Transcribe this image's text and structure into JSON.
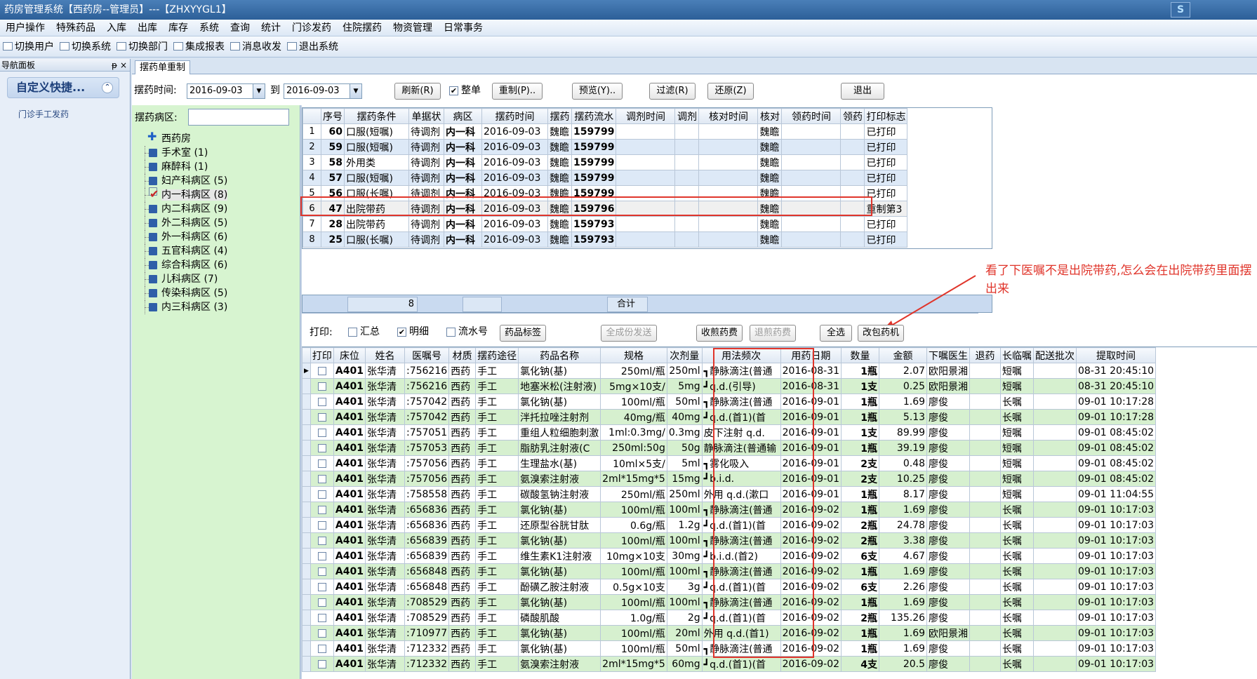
{
  "window": {
    "title": "药房管理系统【西药房--管理员】---【ZHXYYGL1】",
    "logo": "S"
  },
  "menu": [
    "用户操作",
    "特殊药品",
    "入库",
    "出库",
    "库存",
    "系统",
    "查询",
    "统计",
    "门诊发药",
    "住院摆药",
    "物资管理",
    "日常事务"
  ],
  "toolbar": [
    "切换用户",
    "切换系统",
    "切换部门",
    "集成报表",
    "消息收发",
    "退出系统"
  ],
  "nav": {
    "header": "导航面板",
    "pin": "ᵽ",
    "close": "×",
    "group": "自定义快捷...",
    "item": "门诊手工发药"
  },
  "tab": {
    "label": "摆药单重制"
  },
  "filter": {
    "time_label": "摆药时间:",
    "date_from": "2016-09-03",
    "to_label": "到",
    "date_to": "2016-09-03",
    "refresh": "刷新(R)",
    "whole_label": "整单",
    "remake": "重制(P)..",
    "preview": "预览(Y)..",
    "filter_btn": "过滤(R)",
    "restore": "还原(Z)",
    "exit": "退出",
    "ward_label": "摆药病区:"
  },
  "tree": {
    "root": "西药房",
    "items": [
      {
        "label": "手术室 (1)"
      },
      {
        "label": "麻醉科 (1)"
      },
      {
        "label": "妇产科病区 (5)"
      },
      {
        "label": "内一科病区 (8)",
        "checked": true
      },
      {
        "label": "内二科病区 (9)"
      },
      {
        "label": "外二科病区 (5)"
      },
      {
        "label": "外一科病区 (6)"
      },
      {
        "label": "五官科病区 (4)"
      },
      {
        "label": "综合科病区 (6)"
      },
      {
        "label": "儿科病区 (7)"
      },
      {
        "label": "传染科病区 (5)"
      },
      {
        "label": "内三科病区 (3)"
      }
    ]
  },
  "upper": {
    "headers": [
      "",
      "序号",
      "摆药条件",
      "单据状",
      "病区",
      "摆药时间",
      "摆药",
      "摆药流水",
      "调剂时间",
      "调剂",
      "核对时间",
      "核对",
      "领药时间",
      "领药",
      "打印标志"
    ],
    "rows": [
      [
        "1",
        "60",
        "口服(短嘱)",
        "待调剂",
        "内一科",
        "2016-09-03",
        "魏瞻",
        "159799",
        "",
        "",
        "",
        "魏瞻",
        "",
        "",
        "已打印"
      ],
      [
        "2",
        "59",
        "口服(短嘱)",
        "待调剂",
        "内一科",
        "2016-09-03",
        "魏瞻",
        "159799",
        "",
        "",
        "",
        "魏瞻",
        "",
        "",
        "已打印"
      ],
      [
        "3",
        "58",
        "外用类",
        "待调剂",
        "内一科",
        "2016-09-03",
        "魏瞻",
        "159799",
        "",
        "",
        "",
        "魏瞻",
        "",
        "",
        "已打印"
      ],
      [
        "4",
        "57",
        "口服(短嘱)",
        "待调剂",
        "内一科",
        "2016-09-03",
        "魏瞻",
        "159799",
        "",
        "",
        "",
        "魏瞻",
        "",
        "",
        "已打印"
      ],
      [
        "5",
        "56",
        "口服(长嘱)",
        "待调剂",
        "内一科",
        "2016-09-03",
        "魏瞻",
        "159799",
        "",
        "",
        "",
        "魏瞻",
        "",
        "",
        "已打印"
      ],
      [
        "6",
        "47",
        "出院带药",
        "待调剂",
        "内一科",
        "2016-09-03",
        "魏瞻",
        "159796",
        "",
        "",
        "",
        "魏瞻",
        "",
        "",
        "重制第3"
      ],
      [
        "7",
        "28",
        "出院带药",
        "待调剂",
        "内一科",
        "2016-09-03",
        "魏瞻",
        "159793",
        "",
        "",
        "",
        "魏瞻",
        "",
        "",
        "已打印"
      ],
      [
        "8",
        "25",
        "口服(长嘱)",
        "待调剂",
        "内一科",
        "2016-09-03",
        "魏瞻",
        "159793",
        "",
        "",
        "",
        "魏瞻",
        "",
        "",
        "已打印"
      ]
    ],
    "sum_count": "8",
    "sum_label": "合计"
  },
  "annotation": "看了下医嘱不是出院带药,怎么会在出院带药里面摆出来",
  "printbar": {
    "print_label": "打印:",
    "summary": "汇总",
    "detail": "明细",
    "serial": "流水号",
    "drug_label_btn": "药品标签",
    "send_btn": "全成份发送",
    "collect_btn": "收煎药费",
    "refund_btn": "退煎药费",
    "select_all": "全选",
    "change_machine": "改包药机"
  },
  "lower": {
    "headers": [
      "",
      "打印",
      "床位",
      "姓名",
      "医嘱号",
      "材质",
      "摆药途径",
      "药品名称",
      "规格",
      "次剂量",
      "用法频次",
      "用药日期",
      "数量",
      "金额",
      "下嘱医生",
      "退药",
      "长临嘱",
      "配送批次",
      "提取时间"
    ],
    "rows": [
      [
        "A401",
        "张华清",
        ":756216",
        "西药",
        "手工",
        "氯化钠(基)",
        "250ml/瓶",
        "250ml",
        "┓静脉滴注(普通",
        "2016-08-31",
        "1瓶",
        "2.07",
        "欧阳景湘",
        "",
        "短嘱",
        "",
        "08-31 20:45:10"
      ],
      [
        "A401",
        "张华清",
        ":756216",
        "西药",
        "手工",
        "地塞米松(注射液)",
        "5mg×10支/",
        "5mg",
        "┛q.d.(引导)",
        "2016-08-31",
        "1支",
        "0.25",
        "欧阳景湘",
        "",
        "短嘱",
        "",
        "08-31 20:45:10"
      ],
      [
        "A401",
        "张华清",
        ":757042",
        "西药",
        "手工",
        "氯化钠(基)",
        "100ml/瓶",
        "50ml",
        "┓静脉滴注(普通",
        "2016-09-01",
        "1瓶",
        "1.69",
        "廖俊",
        "",
        "长嘱",
        "",
        "09-01 10:17:28"
      ],
      [
        "A401",
        "张华清",
        ":757042",
        "西药",
        "手工",
        "泮托拉唑注射剂",
        "40mg/瓶",
        "40mg",
        "┛q.d.(首1)(首",
        "2016-09-01",
        "1瓶",
        "5.13",
        "廖俊",
        "",
        "长嘱",
        "",
        "09-01 10:17:28"
      ],
      [
        "A401",
        "张华清",
        ":757051",
        "西药",
        "手工",
        "重组人粒细胞刺激",
        "1ml:0.3mg/",
        "0.3mg",
        "皮下注射 q.d.",
        "2016-09-01",
        "1支",
        "89.99",
        "廖俊",
        "",
        "短嘱",
        "",
        "09-01 08:45:02"
      ],
      [
        "A401",
        "张华清",
        ":757053",
        "西药",
        "手工",
        "脂肪乳注射液(C",
        "250ml:50g",
        "50g",
        "静脉滴注(普通输",
        "2016-09-01",
        "1瓶",
        "39.19",
        "廖俊",
        "",
        "短嘱",
        "",
        "09-01 08:45:02"
      ],
      [
        "A401",
        "张华清",
        ":757056",
        "西药",
        "手工",
        "生理盐水(基)",
        "10ml×5支/",
        "5ml",
        "┓雾化吸入",
        "2016-09-01",
        "2支",
        "0.48",
        "廖俊",
        "",
        "短嘱",
        "",
        "09-01 08:45:02"
      ],
      [
        "A401",
        "张华清",
        ":757056",
        "西药",
        "手工",
        "氨溴索注射液",
        "2ml*15mg*5",
        "15mg",
        "┛b.i.d.",
        "2016-09-01",
        "2支",
        "10.25",
        "廖俊",
        "",
        "短嘱",
        "",
        "09-01 08:45:02"
      ],
      [
        "A401",
        "张华清",
        ":758558",
        "西药",
        "手工",
        "碳酸氢钠注射液",
        "250ml/瓶",
        "250ml",
        "外用 q.d.(漱口",
        "2016-09-01",
        "1瓶",
        "8.17",
        "廖俊",
        "",
        "短嘱",
        "",
        "09-01 11:04:55"
      ],
      [
        "A401",
        "张华清",
        ":656836",
        "西药",
        "手工",
        "氯化钠(基)",
        "100ml/瓶",
        "100ml",
        "┓静脉滴注(普通",
        "2016-09-02",
        "1瓶",
        "1.69",
        "廖俊",
        "",
        "长嘱",
        "",
        "09-01 10:17:03"
      ],
      [
        "A401",
        "张华清",
        ":656836",
        "西药",
        "手工",
        "还原型谷胱甘肽",
        "0.6g/瓶",
        "1.2g",
        "┛q.d.(首1)(首",
        "2016-09-02",
        "2瓶",
        "24.78",
        "廖俊",
        "",
        "长嘱",
        "",
        "09-01 10:17:03"
      ],
      [
        "A401",
        "张华清",
        ":656839",
        "西药",
        "手工",
        "氯化钠(基)",
        "100ml/瓶",
        "100ml",
        "┓静脉滴注(普通",
        "2016-09-02",
        "2瓶",
        "3.38",
        "廖俊",
        "",
        "长嘱",
        "",
        "09-01 10:17:03"
      ],
      [
        "A401",
        "张华清",
        ":656839",
        "西药",
        "手工",
        "维生素K1注射液",
        "10mg×10支",
        "30mg",
        "┛b.i.d.(首2)",
        "2016-09-02",
        "6支",
        "4.67",
        "廖俊",
        "",
        "长嘱",
        "",
        "09-01 10:17:03"
      ],
      [
        "A401",
        "张华清",
        ":656848",
        "西药",
        "手工",
        "氯化钠(基)",
        "100ml/瓶",
        "100ml",
        "┓静脉滴注(普通",
        "2016-09-02",
        "1瓶",
        "1.69",
        "廖俊",
        "",
        "长嘱",
        "",
        "09-01 10:17:03"
      ],
      [
        "A401",
        "张华清",
        ":656848",
        "西药",
        "手工",
        "酚磺乙胺注射液",
        "0.5g×10支",
        "3g",
        "┛q.d.(首1)(首",
        "2016-09-02",
        "6支",
        "2.26",
        "廖俊",
        "",
        "长嘱",
        "",
        "09-01 10:17:03"
      ],
      [
        "A401",
        "张华清",
        ":708529",
        "西药",
        "手工",
        "氯化钠(基)",
        "100ml/瓶",
        "100ml",
        "┓静脉滴注(普通",
        "2016-09-02",
        "1瓶",
        "1.69",
        "廖俊",
        "",
        "长嘱",
        "",
        "09-01 10:17:03"
      ],
      [
        "A401",
        "张华清",
        ":708529",
        "西药",
        "手工",
        "磷酸肌酸",
        "1.0g/瓶",
        "2g",
        "┛q.d.(首1)(首",
        "2016-09-02",
        "2瓶",
        "135.26",
        "廖俊",
        "",
        "长嘱",
        "",
        "09-01 10:17:03"
      ],
      [
        "A401",
        "张华清",
        ":710977",
        "西药",
        "手工",
        "氯化钠(基)",
        "100ml/瓶",
        "20ml",
        "外用 q.d.(首1)",
        "2016-09-02",
        "1瓶",
        "1.69",
        "欧阳景湘",
        "",
        "长嘱",
        "",
        "09-01 10:17:03"
      ],
      [
        "A401",
        "张华清",
        ":712332",
        "西药",
        "手工",
        "氯化钠(基)",
        "100ml/瓶",
        "50ml",
        "┓静脉滴注(普通",
        "2016-09-02",
        "1瓶",
        "1.69",
        "廖俊",
        "",
        "长嘱",
        "",
        "09-01 10:17:03"
      ],
      [
        "A401",
        "张华清",
        ":712332",
        "西药",
        "手工",
        "氨溴索注射液",
        "2ml*15mg*5",
        "60mg",
        "┛q.d.(首1)(首",
        "2016-09-02",
        "4支",
        "20.5",
        "廖俊",
        "",
        "长嘱",
        "",
        "09-01 10:17:03"
      ]
    ]
  },
  "colors": {
    "highlight": "#e0352b",
    "greenrow": "#d6f0cf",
    "bluerow": "#dde9f7"
  }
}
